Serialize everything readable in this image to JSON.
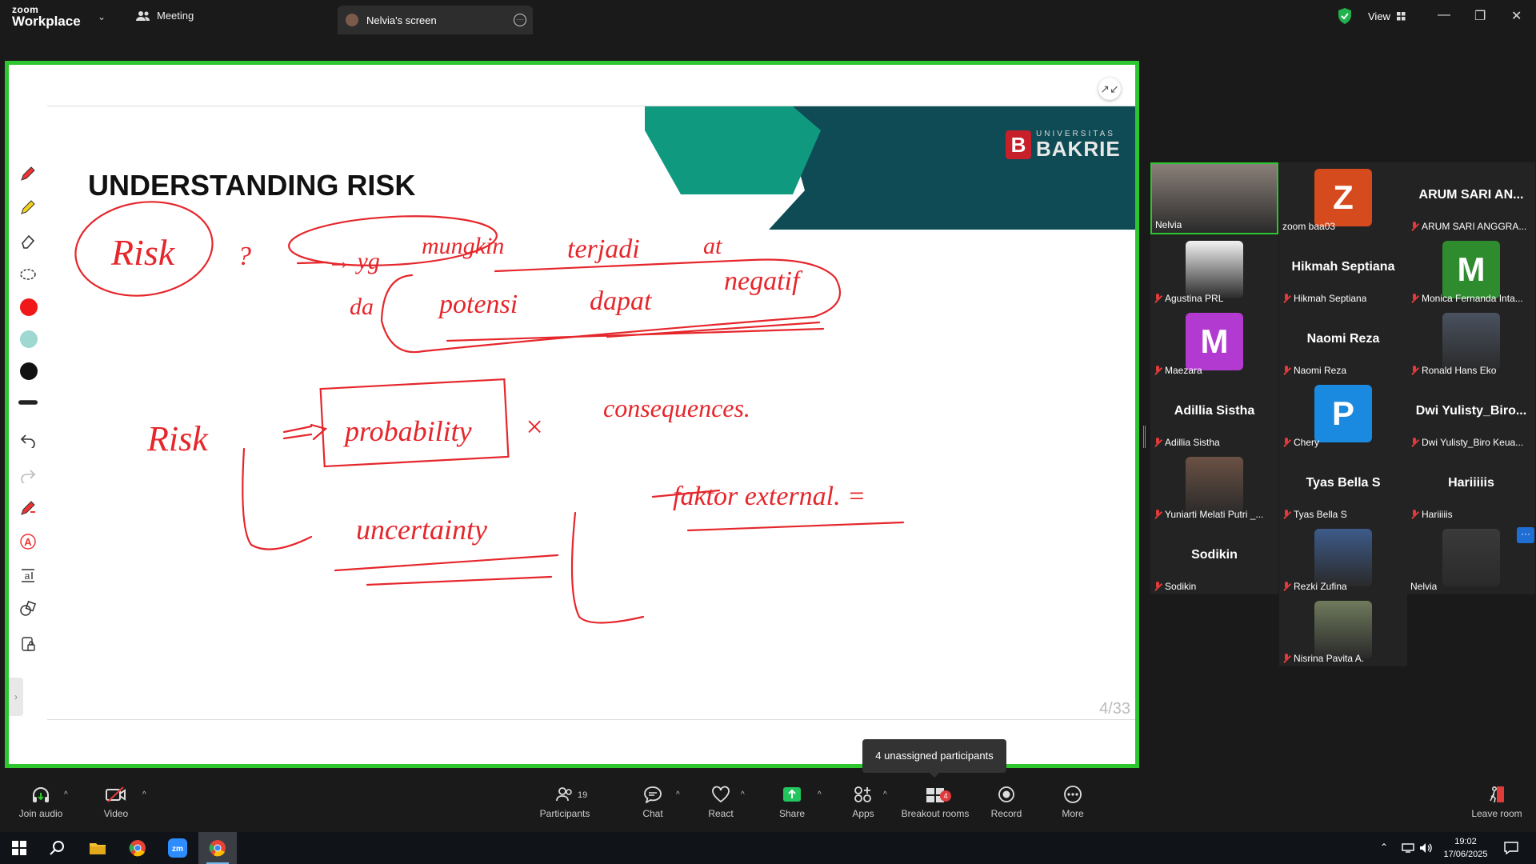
{
  "app": {
    "logo_line1": "zoom",
    "logo_line2": "Workplace"
  },
  "tabs": {
    "meeting": "Meeting",
    "screen": "Nelvia's screen"
  },
  "header": {
    "view_label": "View"
  },
  "slide": {
    "title": "UNDERSTANDING RISK",
    "page": "4/33",
    "brand_line1": "UNIVERSITAS",
    "brand_line2": "BAKRIE",
    "brand_mark": "B",
    "accent_dark": "#0e4b55",
    "accent_teal": "#0f9a80"
  },
  "annotation_color": "#e5262b",
  "annotations": {
    "risk1": "Risk",
    "q": "?",
    "yg": "→ yg",
    "mungkin": "mungkin",
    "terjadi": "terjadi",
    "at": "at",
    "da": "da",
    "potensi": "potensi",
    "dapat": "dapat",
    "negatif": "negatif",
    "risk2": "Risk",
    "probability": "probability",
    "times": "×",
    "consequences": "consequences.",
    "uncertainty": "uncertainty",
    "faktor": "faktor external. ="
  },
  "whiteboard_colors": [
    "#f01818",
    "#9ed8d0",
    "#111111"
  ],
  "participants": [
    {
      "name": "Nelvia",
      "kind": "photo",
      "color": "#8a7f78",
      "muted": false,
      "active": true
    },
    {
      "name": "zoom baa03",
      "kind": "letter",
      "letter": "Z",
      "color": "#d64b1e",
      "muted": false
    },
    {
      "name": "ARUM SARI ANGGRA...",
      "kind": "name",
      "big": "ARUM SARI AN...",
      "muted": true
    },
    {
      "name": "Agustina PRL",
      "kind": "photo",
      "color": "#f2f2f2",
      "muted": true
    },
    {
      "name": "Hikmah Septiana",
      "kind": "name",
      "big": "Hikmah Septiana",
      "muted": true
    },
    {
      "name": "Monica Fernanda Inta...",
      "kind": "letter",
      "letter": "M",
      "color": "#2e8b2e",
      "muted": true
    },
    {
      "name": "Maezara",
      "kind": "letter",
      "letter": "M",
      "color": "#b23ad0",
      "muted": true
    },
    {
      "name": "Naomi Reza",
      "kind": "name",
      "big": "Naomi Reza",
      "muted": true
    },
    {
      "name": "Ronald Hans Eko",
      "kind": "photo",
      "color": "#4a5260",
      "muted": true
    },
    {
      "name": "Adillia Sistha",
      "kind": "name",
      "big": "Adillia Sistha",
      "muted": true
    },
    {
      "name": "Chery",
      "kind": "letter",
      "letter": "P",
      "color": "#1a8ae0",
      "muted": true
    },
    {
      "name": "Dwi Yulisty_Biro Keua...",
      "kind": "name",
      "big": "Dwi  Yulisty_Biro...",
      "muted": true
    },
    {
      "name": "Yuniarti Melati Putri _...",
      "kind": "photo",
      "color": "#6b5144",
      "muted": true
    },
    {
      "name": "Tyas Bella S",
      "kind": "name",
      "big": "Tyas Bella S",
      "muted": true
    },
    {
      "name": "Hariiiiis",
      "kind": "name",
      "big": "Hariiiiis",
      "muted": true
    },
    {
      "name": "Sodikin",
      "kind": "name",
      "big": "Sodikin",
      "muted": true
    },
    {
      "name": "Rezki Zufina",
      "kind": "photo",
      "color": "#3d5b8a",
      "muted": true
    },
    {
      "name": "Nelvia",
      "kind": "photo",
      "color": "#3a3a3a",
      "muted": false
    },
    {
      "name": "Nisrina Pavita A.",
      "kind": "photo",
      "color": "#6f7a5c",
      "muted": true
    }
  ],
  "tooltip": "4 unassigned participants",
  "controls": {
    "join_audio": "Join audio",
    "video": "Video",
    "participants": "Participants",
    "participants_count": "19",
    "chat": "Chat",
    "react": "React",
    "share": "Share",
    "apps": "Apps",
    "breakout": "Breakout rooms",
    "breakout_badge": "4",
    "record": "Record",
    "more": "More",
    "leave": "Leave room"
  },
  "taskbar": {
    "time": "19:02",
    "date": "17/06/2025"
  }
}
